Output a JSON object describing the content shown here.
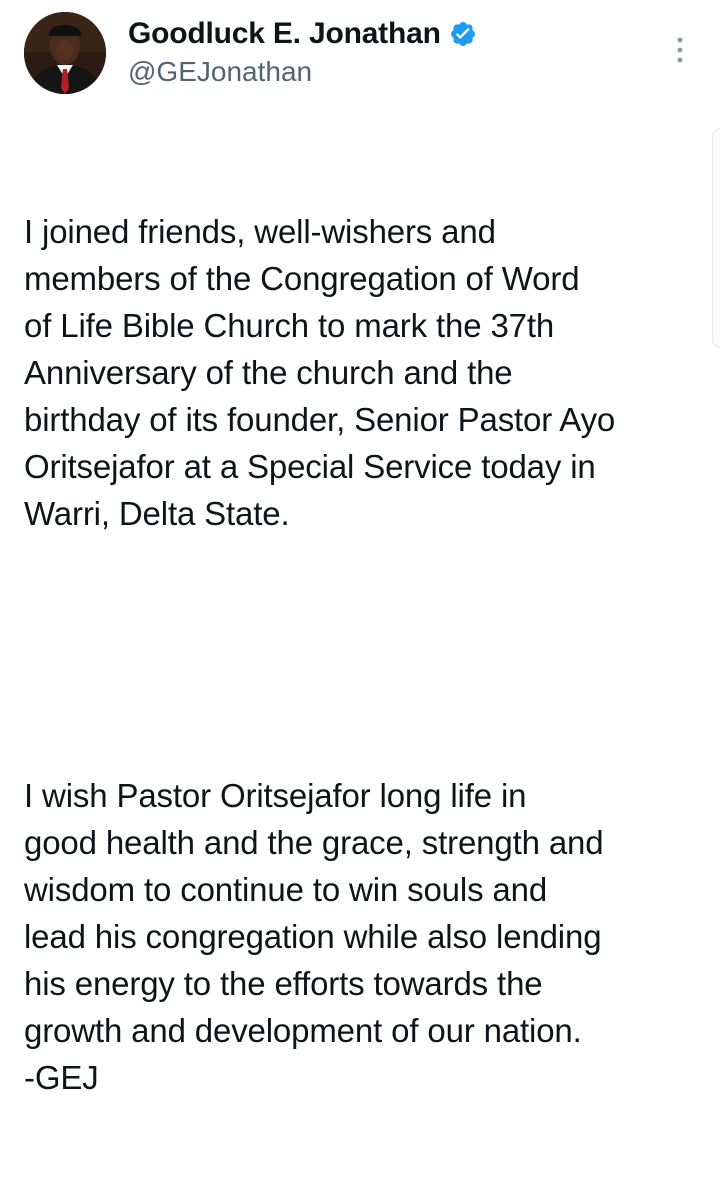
{
  "tweet": {
    "display_name": "Goodluck E. Jonathan",
    "handle": "@GEJonathan",
    "verified": true,
    "paragraphs": [
      "I joined friends, well-wishers and\nmembers of the Congregation of Word\nof Life Bible Church to mark the 37th\nAnniversary of the church and the\nbirthday of its founder, Senior Pastor Ayo\nOritsejafor at a Special Service today in\nWarri, Delta State.",
      "I wish Pastor Oritsejafor long life in\ngood health and the grace, strength and\nwisdom to continue to win souls and\nlead his congregation while also lending\nhis energy to the efforts towards the\ngrowth and development of our nation.\n-GEJ"
    ]
  },
  "icons": {
    "verified": "verified-badge-icon",
    "more": "more-options-icon"
  },
  "colors": {
    "verified_blue": "#1d9bf0",
    "text_primary": "#0f1419",
    "text_secondary": "#536471"
  }
}
